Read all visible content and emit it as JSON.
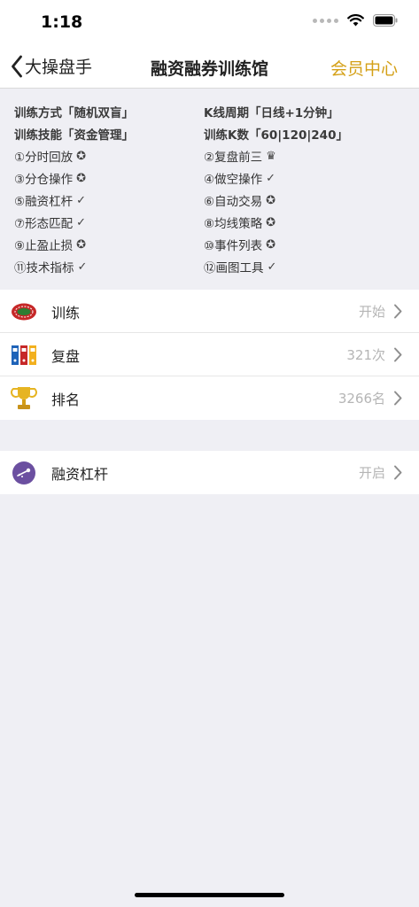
{
  "status": {
    "time": "1:18"
  },
  "nav": {
    "back_label": "大操盘手",
    "title": "融资融券训练馆",
    "right_label": "会员中心"
  },
  "info": {
    "settings": [
      {
        "left": "训练方式「随机双盲」",
        "right": "K线周期「日线+1分钟」"
      },
      {
        "left": "训练技能「资金管理」",
        "right": "训练K数「60|120|240」"
      }
    ],
    "features": [
      {
        "left": {
          "label": "①分时回放",
          "mark": "✪"
        },
        "right": {
          "label": "②复盘前三",
          "mark": "♛"
        }
      },
      {
        "left": {
          "label": "③分仓操作",
          "mark": "✪"
        },
        "right": {
          "label": "④做空操作",
          "mark": "✓"
        }
      },
      {
        "left": {
          "label": "⑤融资杠杆",
          "mark": "✓"
        },
        "right": {
          "label": "⑥自动交易",
          "mark": "✪"
        }
      },
      {
        "left": {
          "label": "⑦形态匹配",
          "mark": "✓"
        },
        "right": {
          "label": "⑧均线策略",
          "mark": "✪"
        }
      },
      {
        "left": {
          "label": "⑨止盈止损",
          "mark": "✪"
        },
        "right": {
          "label": "⑩事件列表",
          "mark": "✪"
        }
      },
      {
        "left": {
          "label": "⑪技术指标",
          "mark": "✓"
        },
        "right": {
          "label": "⑫画图工具",
          "mark": "✓"
        }
      }
    ]
  },
  "menu": [
    {
      "label": "训练",
      "value": "开始",
      "icon": "race-track-icon"
    },
    {
      "label": "复盘",
      "value": "321次",
      "icon": "binders-icon"
    },
    {
      "label": "排名",
      "value": "3266名",
      "icon": "trophy-icon"
    }
  ],
  "leverage": {
    "label": "融资杠杆",
    "value": "开启",
    "icon": "leverage-icon",
    "color": "#6b4fa0"
  },
  "colors": {
    "accent": "#d4a017",
    "background": "#efeff4"
  }
}
